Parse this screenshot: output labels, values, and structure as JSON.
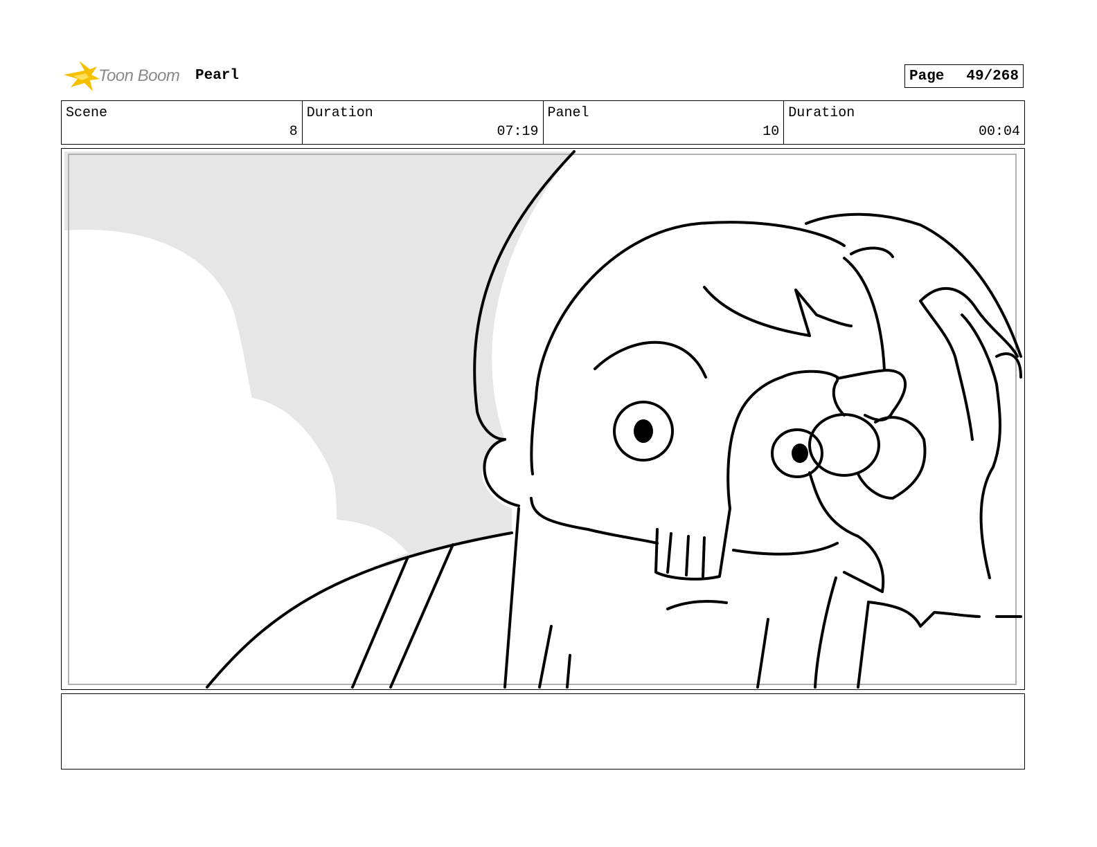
{
  "header": {
    "logo_text": "Toon Boom",
    "project": "Pearl",
    "page_label": "Page",
    "page_value": "49/268"
  },
  "info": {
    "scene_label": "Scene",
    "scene_value": "8",
    "scene_duration_label": "Duration",
    "scene_duration_value": "07:19",
    "panel_label": "Panel",
    "panel_value": "10",
    "panel_duration_label": "Duration",
    "panel_duration_value": "00:04"
  },
  "notes": {
    "text": ""
  },
  "colors": {
    "logo_yellow": "#f5c000",
    "sky_gray": "#e6e6e6",
    "frame_gray": "#b0b0b0"
  }
}
